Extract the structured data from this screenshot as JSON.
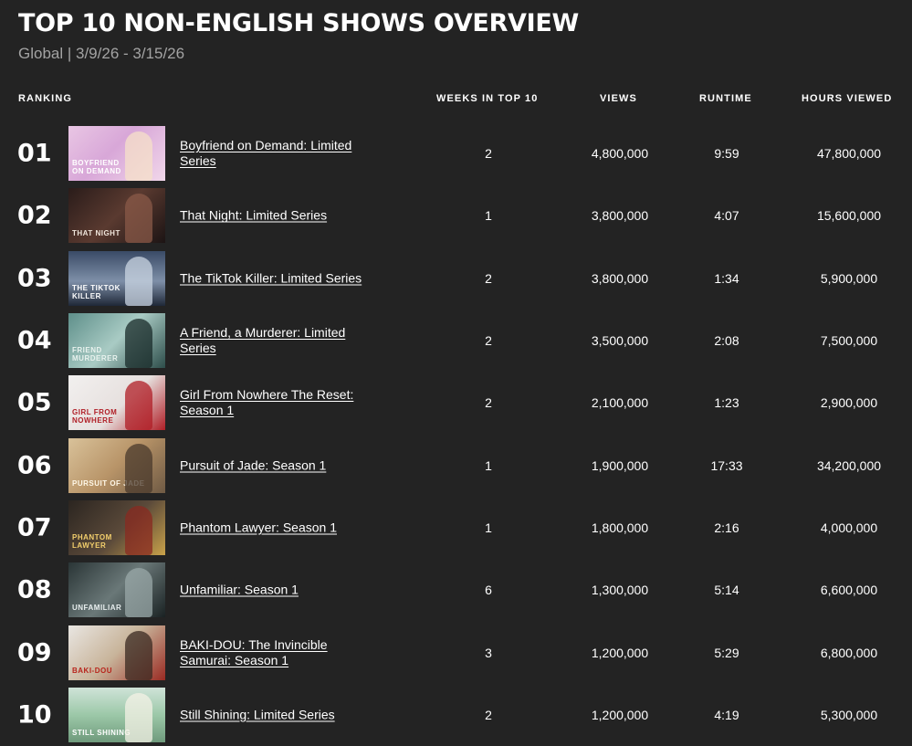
{
  "title": "TOP 10 NON-ENGLISH SHOWS OVERVIEW",
  "subtitle": "Global | 3/9/26 - 3/15/26",
  "columns": {
    "ranking": "RANKING",
    "weeks": "WEEKS IN TOP 10",
    "views": "VIEWS",
    "runtime": "RUNTIME",
    "hours": "HOURS VIEWED"
  },
  "rows": [
    {
      "rank": "01",
      "name": "Boyfriend on Demand: Limited Series",
      "weeks": "2",
      "views": "4,800,000",
      "runtime": "9:59",
      "hours": "47,800,000",
      "thumb": {
        "bg": "linear-gradient(135deg,#e9c6e4 0%,#d8a7d8 45%,#f1d7ea 100%)",
        "caption": "BOYFRIEND\nON DEMAND",
        "captionColor": "#ffffff",
        "accent": "#f6e0c8"
      }
    },
    {
      "rank": "02",
      "name": "That Night: Limited Series",
      "weeks": "1",
      "views": "3,800,000",
      "runtime": "4:07",
      "hours": "15,600,000",
      "thumb": {
        "bg": "linear-gradient(135deg,#2a1c1a 0%,#5a3a30 50%,#1c1414 100%)",
        "caption": "THAT NIGHT",
        "captionColor": "#f0e6dc",
        "accent": "#8a5a48"
      }
    },
    {
      "rank": "03",
      "name": "The TikTok Killer: Limited Series",
      "weeks": "2",
      "views": "3,800,000",
      "runtime": "1:34",
      "hours": "5,900,000",
      "thumb": {
        "bg": "linear-gradient(180deg,#3a4b66 0%,#7e8fa8 55%,#1f2838 100%)",
        "caption": "THE TIKTOK\nKILLER",
        "captionColor": "#ffffff",
        "accent": "#c9d4e2"
      }
    },
    {
      "rank": "04",
      "name": "A Friend, a Murderer: Limited Series",
      "weeks": "2",
      "views": "3,500,000",
      "runtime": "2:08",
      "hours": "7,500,000",
      "thumb": {
        "bg": "linear-gradient(135deg,#5e8f8a 0%,#a9cbc4 50%,#2d4d4a 100%)",
        "caption": "FRIEND\nMURDERER",
        "captionColor": "#e8f2ee",
        "accent": "#1a2b2a"
      }
    },
    {
      "rank": "05",
      "name": "Girl From Nowhere The Reset: Season 1",
      "weeks": "2",
      "views": "2,100,000",
      "runtime": "1:23",
      "hours": "2,900,000",
      "thumb": {
        "bg": "linear-gradient(135deg,#f2f0ef 0%,#e6e0de 55%,#b01e26 100%)",
        "caption": "GIRL FROM\nNOWHERE",
        "captionColor": "#b01e26",
        "accent": "#b01e26"
      }
    },
    {
      "rank": "06",
      "name": "Pursuit of Jade: Season 1",
      "weeks": "1",
      "views": "1,900,000",
      "runtime": "17:33",
      "hours": "34,200,000",
      "thumb": {
        "bg": "linear-gradient(135deg,#d9c29a 0%,#b89468 50%,#6f5a44 100%)",
        "caption": "Pursuit of Jade",
        "captionColor": "#fff8e8",
        "accent": "#4a3a2c"
      }
    },
    {
      "rank": "07",
      "name": "Phantom Lawyer: Season 1",
      "weeks": "1",
      "views": "1,800,000",
      "runtime": "2:16",
      "hours": "4,000,000",
      "thumb": {
        "bg": "linear-gradient(135deg,#2b2520 0%,#5b4a3a 55%,#c9a24a 100%)",
        "caption": "PHANTOM\nLAWYER",
        "captionColor": "#f3cf6c",
        "accent": "#8a2a20"
      }
    },
    {
      "rank": "08",
      "name": "Unfamiliar: Season 1",
      "weeks": "6",
      "views": "1,300,000",
      "runtime": "5:14",
      "hours": "6,600,000",
      "thumb": {
        "bg": "linear-gradient(135deg,#2a3536 0%,#6a7878 50%,#1a2223 100%)",
        "caption": "UNFAMILIAR",
        "captionColor": "#e8eeee",
        "accent": "#9aa8a8"
      }
    },
    {
      "rank": "09",
      "name": "BAKI-DOU: The Invincible Samurai: Season 1",
      "weeks": "3",
      "views": "1,200,000",
      "runtime": "5:29",
      "hours": "6,800,000",
      "thumb": {
        "bg": "linear-gradient(135deg,#e9e6e2 0%,#c8b49a 50%,#9a2a22 100%)",
        "caption": "BAKI-DOU",
        "captionColor": "#b8241c",
        "accent": "#3a2a22"
      }
    },
    {
      "rank": "10",
      "name": "Still Shining: Limited Series",
      "weeks": "2",
      "views": "1,200,000",
      "runtime": "4:19",
      "hours": "5,300,000",
      "thumb": {
        "bg": "linear-gradient(180deg,#cfe3d8 0%,#9cc8a8 50%,#6f9a7c 100%)",
        "caption": "Still Shining",
        "captionColor": "#ffffff",
        "accent": "#f4f1e6"
      }
    }
  ]
}
